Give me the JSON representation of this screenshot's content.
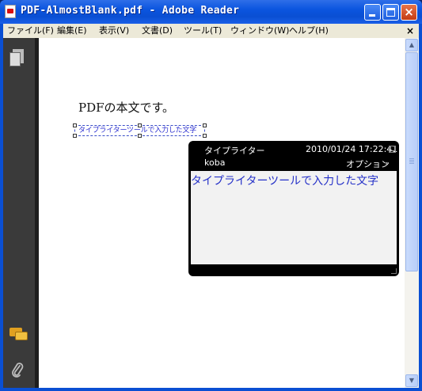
{
  "window": {
    "title": "PDF-AlmostBlank.pdf - Adobe Reader",
    "close_glyph": "×"
  },
  "menu": {
    "items": [
      {
        "label": "ファイル(F)"
      },
      {
        "label": "編集(E)"
      },
      {
        "label": "表示(V)"
      },
      {
        "label": "文書(D)"
      },
      {
        "label": "ツール(T)"
      },
      {
        "label": "ウィンドウ(W)"
      },
      {
        "label": "ヘルプ(H)"
      }
    ],
    "close_glyph": "×"
  },
  "nav": {
    "pages_icon": "pages-icon",
    "comments_icon": "comments-icon",
    "attachments_icon": "paperclip-icon",
    "attach_glyph": "⚲"
  },
  "document": {
    "body_text": "PDFの本文です。",
    "typewriter_text": "タイプライターツールで入力した文字"
  },
  "popup": {
    "title": "タイプライター",
    "date": "2010/01/24 17:22:41",
    "author": "koba",
    "options_label": "オプション",
    "options_arrow": "▾",
    "content": "タイプライターツールで入力した文字"
  },
  "scrollbar": {
    "up_glyph": "▲",
    "down_glyph": "▼"
  },
  "colors": {
    "titlebar": "#0b55df",
    "nav_panel": "#3a3a3a",
    "popup_bg": "#000000",
    "annotation_text": "#2430c8"
  }
}
